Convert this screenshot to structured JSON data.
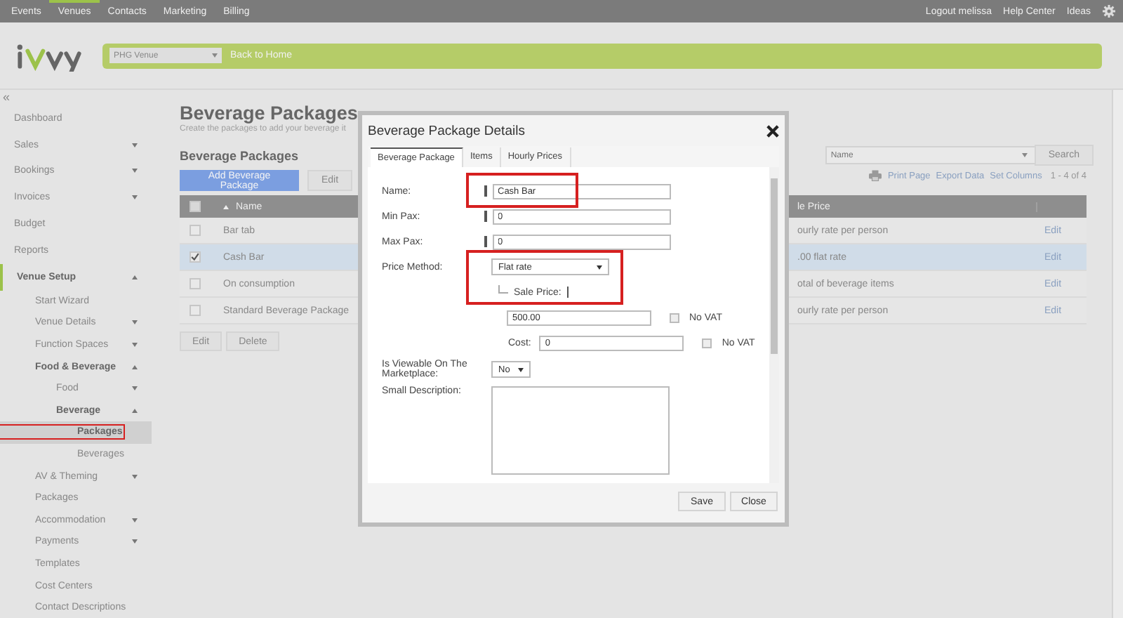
{
  "top_nav": {
    "tabs": [
      {
        "label": "Events",
        "selected": false
      },
      {
        "label": "Venues",
        "selected": true
      },
      {
        "label": "Contacts",
        "selected": false
      },
      {
        "label": "Marketing",
        "selected": false
      },
      {
        "label": "Billing",
        "selected": false
      }
    ],
    "links": [
      "Logout melissa",
      "Help Center",
      "Ideas"
    ]
  },
  "header": {
    "venue_select": "PHG Venue",
    "back_link": "Back to Home"
  },
  "sidebar": {
    "collapse": "«",
    "items": [
      {
        "label": "Dashboard",
        "selected": false
      },
      {
        "label": "Sales",
        "selected": false,
        "expanded": false
      },
      {
        "label": "Bookings",
        "selected": false,
        "expanded": false
      },
      {
        "label": "Invoices",
        "selected": false,
        "expanded": false
      },
      {
        "label": "Budget",
        "selected": false
      },
      {
        "label": "Reports",
        "selected": false
      },
      {
        "label": "Venue Setup",
        "selected": false,
        "expanded": true,
        "children": [
          {
            "label": "Start Wizard",
            "selected": false
          },
          {
            "label": "Venue Details",
            "selected": false,
            "expanded": false
          },
          {
            "label": "Function Spaces",
            "selected": false,
            "expanded": false
          },
          {
            "label": "Food & Beverage",
            "selected": false,
            "expanded": true,
            "children": [
              {
                "label": "Food",
                "selected": false,
                "expanded": false
              },
              {
                "label": "Beverage",
                "selected": false,
                "expanded": true,
                "children": [
                  {
                    "label": "Packages",
                    "selected": true,
                    "highlighted": true
                  },
                  {
                    "label": "Beverages",
                    "selected": false
                  }
                ]
              }
            ]
          },
          {
            "label": "AV & Theming",
            "selected": false,
            "expanded": false
          },
          {
            "label": "Packages",
            "selected": false
          },
          {
            "label": "Accommodation",
            "selected": false,
            "expanded": false
          },
          {
            "label": "Payments",
            "selected": false,
            "expanded": false
          },
          {
            "label": "Templates",
            "selected": false
          },
          {
            "label": "Cost Centers",
            "selected": false
          },
          {
            "label": "Contact Descriptions",
            "selected": false
          }
        ]
      }
    ]
  },
  "page": {
    "title": "Beverage Packages",
    "subtitle": "Create the packages to add your beverage it",
    "section_title": "Beverage Packages",
    "buttons": [
      "Add Beverage Package",
      "Edit"
    ],
    "search": {
      "placeholder": "Name",
      "button": "Search"
    },
    "tools": [
      "Print Page",
      "Export Data",
      "Set Columns"
    ],
    "count": "1 - 4 of 4"
  },
  "table": {
    "all_checked": false,
    "columns": [
      "Name",
      "le Price"
    ],
    "rows": [
      {
        "checked": false,
        "selected": false,
        "name": "Bar tab",
        "column_3": "ourly rate per person",
        "action": "Edit"
      },
      {
        "checked": true,
        "selected": true,
        "name": "Cash Bar",
        "column_3": ".00 flat rate",
        "action": "Edit"
      },
      {
        "checked": false,
        "selected": false,
        "name": "On consumption",
        "column_3": "otal of beverage items",
        "action": "Edit"
      },
      {
        "checked": false,
        "selected": false,
        "name": "Standard Beverage Package",
        "column_3": "ourly rate per person",
        "action": "Edit"
      }
    ],
    "buttons": [
      "Edit",
      "Delete"
    ]
  },
  "dialog": {
    "title": "Beverage Package Details",
    "tabs": [
      {
        "label": "Beverage Package",
        "selected": true
      },
      {
        "label": "Items",
        "selected": false
      },
      {
        "label": "Hourly Prices",
        "selected": false
      }
    ],
    "form": {
      "name": {
        "label": "Name:",
        "value": "Cash Bar",
        "highlighted": true
      },
      "min_pax": {
        "label": "Min Pax:",
        "value": "0"
      },
      "max_pax": {
        "label": "Max Pax:",
        "value": "0"
      },
      "price_method": {
        "label": "Price Method:",
        "value": "Flat rate",
        "highlighted": true
      },
      "sale_price": {
        "label": "Sale Price:",
        "value": "500.00",
        "no_vat": {
          "label": "No VAT",
          "checked": false
        }
      },
      "cost": {
        "label": "Cost:",
        "value": "0",
        "no_vat": {
          "label": "No VAT",
          "checked": false
        }
      },
      "marketplace": {
        "label": "Is Viewable On The Marketplace:",
        "value": "No"
      },
      "small_description": {
        "label": "Small Description:"
      }
    },
    "buttons": [
      "Save",
      "Close"
    ]
  }
}
